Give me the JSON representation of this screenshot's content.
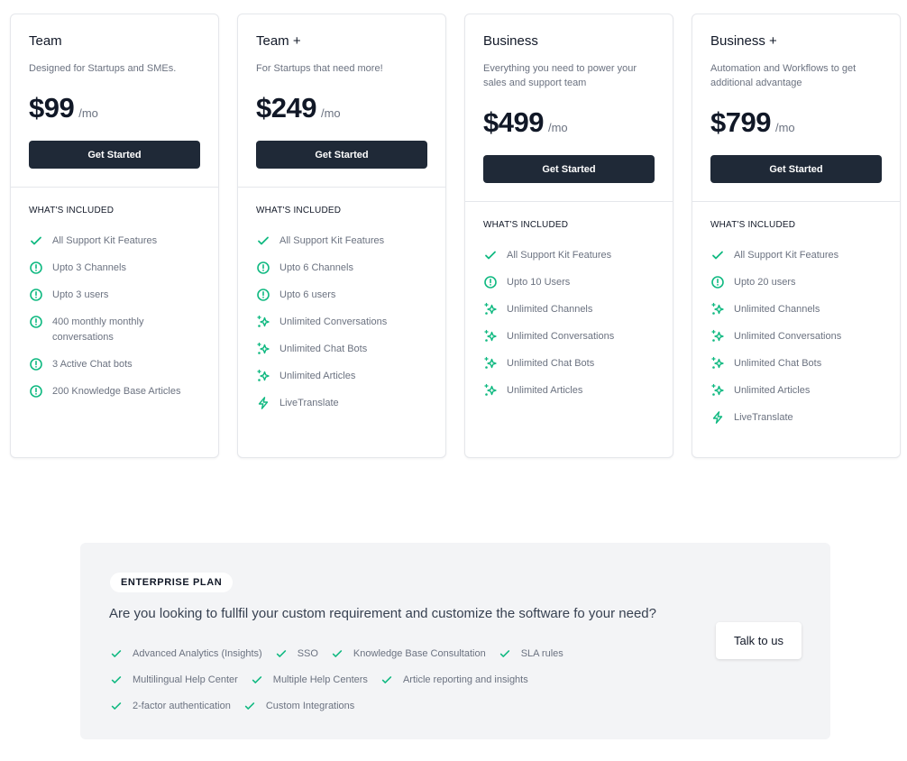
{
  "colors": {
    "accent": "#10b981",
    "button_dark": "#1f2937",
    "muted_text": "#6b7280"
  },
  "plans": [
    {
      "name": "Team",
      "description": "Designed for Startups and SMEs.",
      "price": "$99",
      "period": "/mo",
      "cta": "Get Started",
      "included_label": "WHAT'S INCLUDED",
      "features": [
        {
          "icon": "check-icon",
          "text": "All Support Kit Features"
        },
        {
          "icon": "alert-circle-icon",
          "text": "Upto 3 Channels"
        },
        {
          "icon": "alert-circle-icon",
          "text": "Upto 3 users"
        },
        {
          "icon": "alert-circle-icon",
          "text": "400 monthly monthly conversations"
        },
        {
          "icon": "alert-circle-icon",
          "text": "3 Active Chat bots"
        },
        {
          "icon": "alert-circle-icon",
          "text": "200 Knowledge Base Articles"
        }
      ]
    },
    {
      "name": "Team +",
      "description": "For Startups that need more!",
      "price": "$249",
      "period": "/mo",
      "cta": "Get Started",
      "included_label": "WHAT'S INCLUDED",
      "features": [
        {
          "icon": "check-icon",
          "text": "All Support Kit Features"
        },
        {
          "icon": "alert-circle-icon",
          "text": "Upto 6 Channels"
        },
        {
          "icon": "alert-circle-icon",
          "text": "Upto 6 users"
        },
        {
          "icon": "sparkles-icon",
          "text": "Unlimited Conversations"
        },
        {
          "icon": "sparkles-icon",
          "text": "Unlimited Chat Bots"
        },
        {
          "icon": "sparkles-icon",
          "text": "Unlimited Articles"
        },
        {
          "icon": "lightning-icon",
          "text": "LiveTranslate"
        }
      ]
    },
    {
      "name": "Business",
      "description": "Everything you need to power your sales and support team",
      "price": "$499",
      "period": "/mo",
      "cta": "Get Started",
      "included_label": "WHAT'S INCLUDED",
      "features": [
        {
          "icon": "check-icon",
          "text": "All Support Kit Features"
        },
        {
          "icon": "alert-circle-icon",
          "text": "Upto 10 Users"
        },
        {
          "icon": "sparkles-icon",
          "text": "Unlimited Channels"
        },
        {
          "icon": "sparkles-icon",
          "text": "Unlimited Conversations"
        },
        {
          "icon": "sparkles-icon",
          "text": "Unlimited Chat Bots"
        },
        {
          "icon": "sparkles-icon",
          "text": "Unlimited Articles"
        }
      ]
    },
    {
      "name": "Business +",
      "description": "Automation and Workflows to get additional advantage",
      "price": "$799",
      "period": "/mo",
      "cta": "Get Started",
      "included_label": "WHAT'S INCLUDED",
      "features": [
        {
          "icon": "check-icon",
          "text": "All Support Kit Features"
        },
        {
          "icon": "alert-circle-icon",
          "text": "Upto 20 users"
        },
        {
          "icon": "sparkles-icon",
          "text": "Unlimited Channels"
        },
        {
          "icon": "sparkles-icon",
          "text": "Unlimited Conversations"
        },
        {
          "icon": "sparkles-icon",
          "text": "Unlimited Chat Bots"
        },
        {
          "icon": "sparkles-icon",
          "text": "Unlimited Articles"
        },
        {
          "icon": "lightning-icon",
          "text": "LiveTranslate"
        }
      ]
    }
  ],
  "enterprise": {
    "badge": "ENTERPRISE PLAN",
    "question": "Are you looking to fullfil your custom requirement and customize the software fo your need?",
    "cta": "Talk to us",
    "feature_rows": [
      [
        "Advanced Analytics (Insights)",
        "SSO",
        "Knowledge Base Consultation",
        "SLA rules"
      ],
      [
        "Multilingual Help Center",
        "Multiple Help Centers",
        "Article reporting and insights"
      ],
      [
        "2-factor authentication",
        "Custom Integrations"
      ]
    ]
  }
}
